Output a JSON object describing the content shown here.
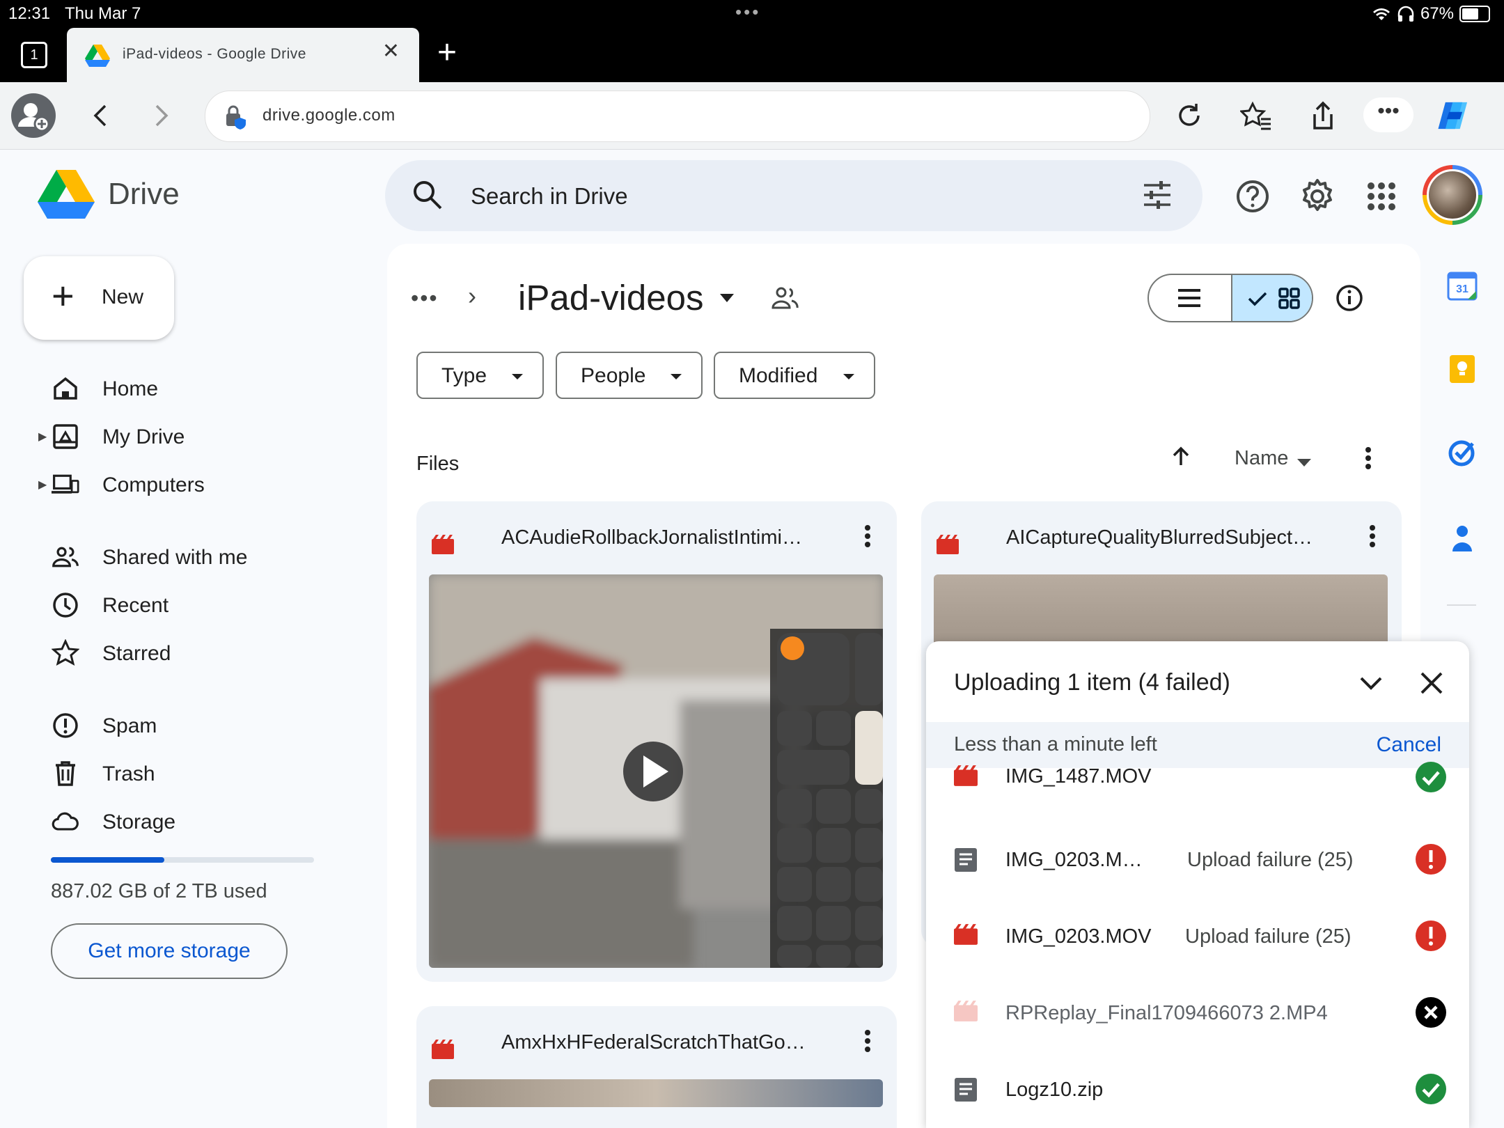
{
  "status": {
    "time": "12:31",
    "date": "Thu Mar 7",
    "battery": "67%",
    "battery_level": 0.67
  },
  "browser": {
    "tab_count": "1",
    "tab_title": "iPad-videos - Google Drive",
    "url": "drive.google.com"
  },
  "header": {
    "app_name": "Drive",
    "search_placeholder": "Search in Drive"
  },
  "sidebar": {
    "new_label": "New",
    "items": [
      {
        "label": "Home",
        "icon": "home-icon"
      },
      {
        "label": "My Drive",
        "icon": "my-drive-icon"
      },
      {
        "label": "Computers",
        "icon": "computers-icon"
      },
      {
        "label": "Shared with me",
        "icon": "shared-icon"
      },
      {
        "label": "Recent",
        "icon": "clock-icon"
      },
      {
        "label": "Starred",
        "icon": "star-icon"
      },
      {
        "label": "Spam",
        "icon": "spam-icon"
      },
      {
        "label": "Trash",
        "icon": "trash-icon"
      },
      {
        "label": "Storage",
        "icon": "cloud-icon"
      }
    ],
    "storage_used_fraction": 0.43,
    "storage_text": "887.02 GB of 2 TB used",
    "get_more_label": "Get more storage"
  },
  "main": {
    "breadcrumb_more": "•••",
    "folder_title": "iPad-videos",
    "filters": [
      "Type",
      "People",
      "Modified"
    ],
    "files_label": "Files",
    "sort_label": "Name",
    "files": [
      {
        "name": "ACAudieRollbackJornalistIntimi…"
      },
      {
        "name": "AICaptureQualityBlurredSubject…"
      },
      {
        "name": "AmxHxHFederalScratchThatGo…"
      }
    ]
  },
  "upload": {
    "title": "Uploading 1 item (4 failed)",
    "time_left": "Less than a minute left",
    "cancel_label": "Cancel",
    "items": [
      {
        "name": "IMG_1487.MOV",
        "status": "",
        "type": "video",
        "state": "success"
      },
      {
        "name": "IMG_0203.M…",
        "status": "Upload failure (25)",
        "type": "doc",
        "state": "error"
      },
      {
        "name": "IMG_0203.MOV",
        "status": "Upload failure (25)",
        "type": "video",
        "state": "error"
      },
      {
        "name": "RPReplay_Final1709466073 2.MP4",
        "status": "",
        "type": "video-faded",
        "state": "cancelled"
      },
      {
        "name": "Logz10.zip",
        "status": "",
        "type": "doc",
        "state": "success"
      }
    ]
  },
  "colors": {
    "accent": "#0b57d0",
    "error": "#d93025",
    "success": "#1e8e3e",
    "video_red": "#d93025"
  }
}
